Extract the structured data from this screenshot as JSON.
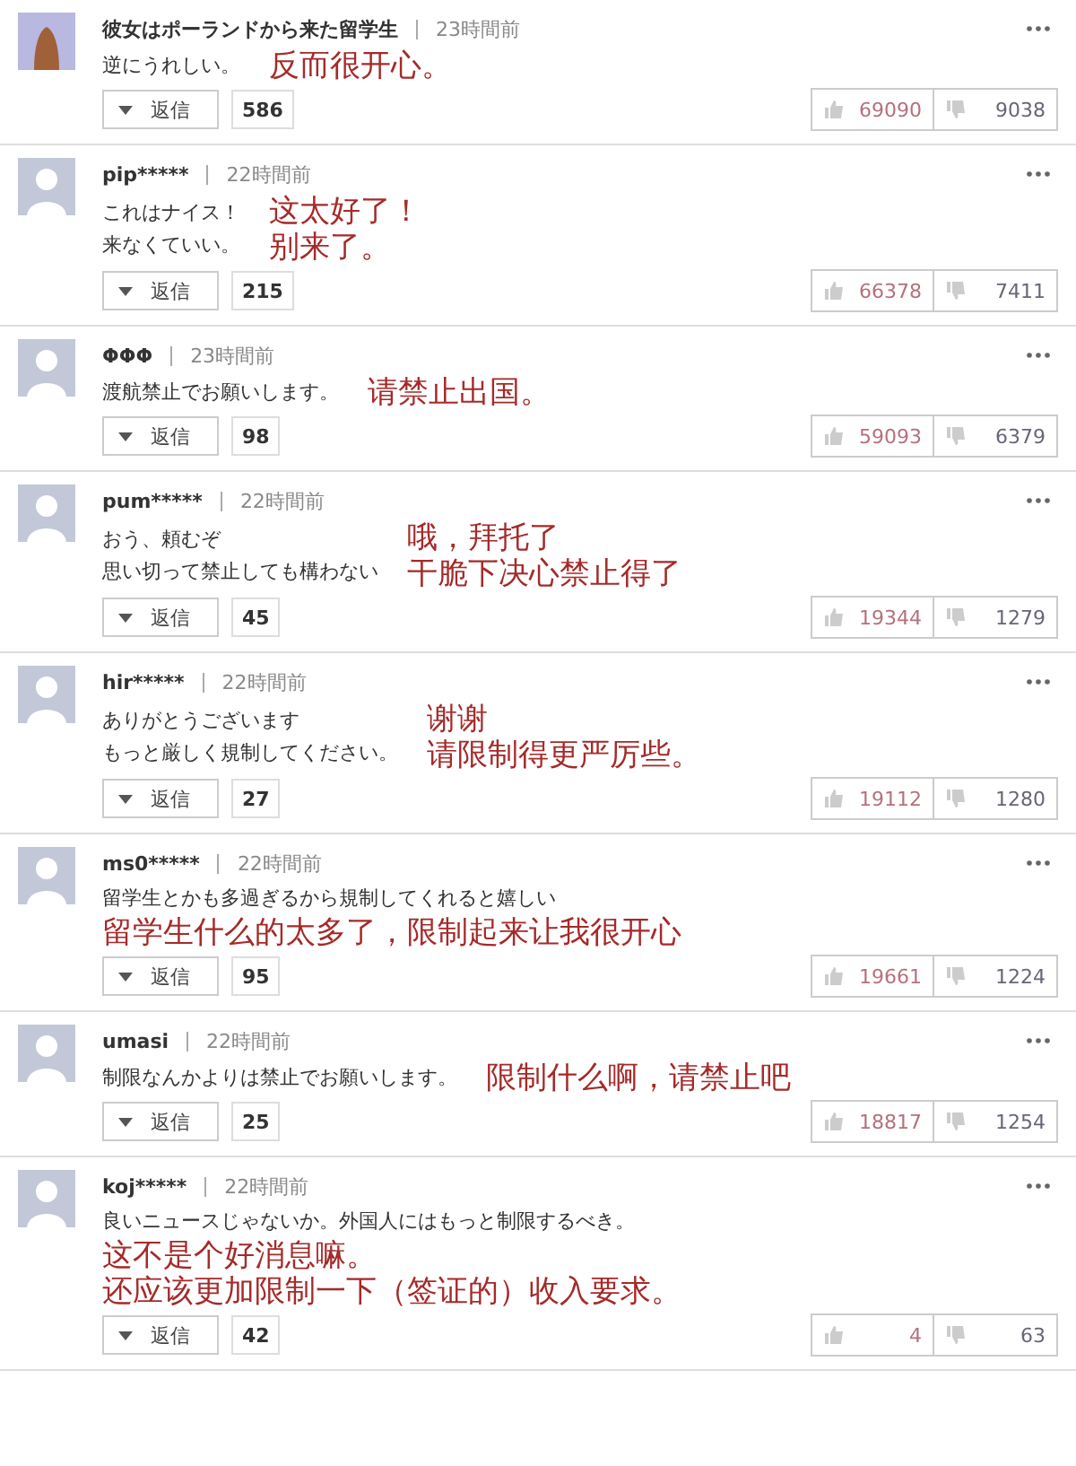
{
  "comments": [
    {
      "avatar": {
        "kind": "photo"
      },
      "name": "彼女はポーランドから来た留学生",
      "time": "23時間前",
      "body": [
        "逆にうれしい。"
      ],
      "translation": [
        "反而很开心。"
      ],
      "reply_button": "返信",
      "replies": "586",
      "likes": "69090",
      "dislikes": "9038"
    },
    {
      "avatar": {
        "kind": "default"
      },
      "name": "pip*****",
      "time": "22時間前",
      "body": [
        "これはナイス！",
        "来なくていい。"
      ],
      "translation": [
        "这太好了！",
        "别来了。"
      ],
      "reply_button": "返信",
      "replies": "215",
      "likes": "66378",
      "dislikes": "7411"
    },
    {
      "avatar": {
        "kind": "default"
      },
      "name": "ΦΦΦ",
      "time": "23時間前",
      "body": [
        "渡航禁止でお願いします。"
      ],
      "translation": [
        "请禁止出国。"
      ],
      "reply_button": "返信",
      "replies": "98",
      "likes": "59093",
      "dislikes": "6379"
    },
    {
      "avatar": {
        "kind": "default"
      },
      "name": "pum*****",
      "time": "22時間前",
      "body": [
        "おう、頼むぞ",
        "思い切って禁止しても構わない"
      ],
      "translation": [
        "哦，拜托了",
        "干脆下决心禁止得了"
      ],
      "reply_button": "返信",
      "replies": "45",
      "likes": "19344",
      "dislikes": "1279"
    },
    {
      "avatar": {
        "kind": "default"
      },
      "name": "hir*****",
      "time": "22時間前",
      "body": [
        "ありがとうございます",
        "もっと厳しく規制してください。"
      ],
      "translation": [
        "谢谢",
        "请限制得更严厉些。"
      ],
      "reply_button": "返信",
      "replies": "27",
      "likes": "19112",
      "dislikes": "1280"
    },
    {
      "avatar": {
        "kind": "default"
      },
      "name": "ms0*****",
      "time": "22時間前",
      "body": [
        "留学生とかも多過ぎるから規制してくれると嬉しい"
      ],
      "translation": [
        "留学生什么的太多了，限制起来让我很开心"
      ],
      "reply_button": "返信",
      "replies": "95",
      "likes": "19661",
      "dislikes": "1224"
    },
    {
      "avatar": {
        "kind": "default"
      },
      "name": "umasi",
      "time": "22時間前",
      "body": [
        "制限なんかよりは禁止でお願いします。"
      ],
      "translation": [
        "限制什么啊，请禁止吧"
      ],
      "reply_button": "返信",
      "replies": "25",
      "likes": "18817",
      "dislikes": "1254"
    },
    {
      "avatar": {
        "kind": "default"
      },
      "name": "koj*****",
      "time": "22時間前",
      "body": [
        "良いニュースじゃないか。外国人にはもっと制限するべき。"
      ],
      "translation": [
        "这不是个好消息嘛。",
        "还应该更加限制一下（签证的）收入要求。"
      ],
      "reply_button": "返信",
      "replies": "42",
      "likes": "4",
      "dislikes": "63"
    }
  ]
}
